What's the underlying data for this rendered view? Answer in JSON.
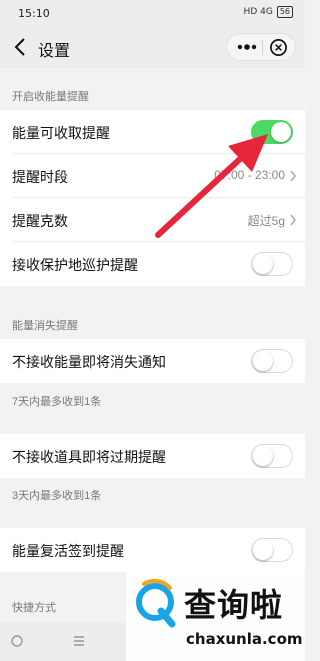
{
  "status_bar": {
    "time": "15:10",
    "indicators": "HD 4G",
    "battery": "56"
  },
  "nav": {
    "title": "设置",
    "back_icon": "back-arrow-icon",
    "more_icon": "more-dots-icon",
    "close_icon": "close-circle-icon"
  },
  "sections": {
    "energy_reminders": {
      "header": "开启收能量提醒",
      "rows": [
        {
          "label": "能量可收取提醒",
          "toggle": true
        },
        {
          "label": "提醒时段",
          "value": "07:00 - 23:00"
        },
        {
          "label": "提醒克数",
          "value": "超过5g"
        },
        {
          "label": "接收保护地巡护提醒",
          "toggle": false
        }
      ]
    },
    "energy_disappear": {
      "header": "能量消失提醒",
      "row": {
        "label": "不接收能量即将消失通知",
        "toggle": false
      },
      "note": "7天内最多收到1条"
    },
    "prop_expire": {
      "row": {
        "label": "不接收道具即将过期提醒",
        "toggle": false
      },
      "note": "3天内最多收到1条"
    },
    "revive": {
      "row": {
        "label": "能量复活签到提醒",
        "toggle": false
      }
    },
    "shortcuts": {
      "header": "快捷方式"
    }
  },
  "annotation": {
    "arrow_color": "#e6263a"
  },
  "colors": {
    "toggle_on": "#4cd964",
    "background": "#f2f2f2"
  },
  "watermark": {
    "title": "查询啦",
    "url": "chaxunla.com"
  }
}
